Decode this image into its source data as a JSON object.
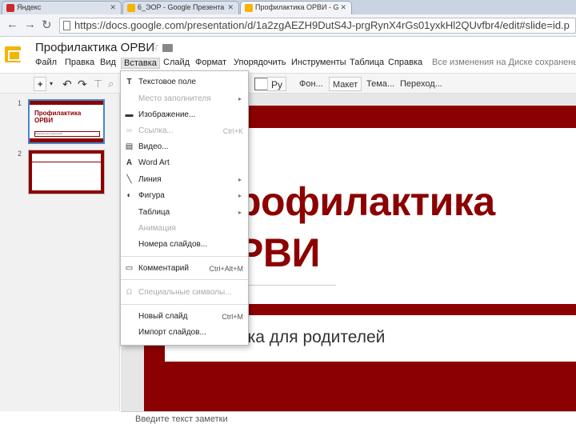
{
  "browser": {
    "tabs": [
      {
        "title": "Яндекс",
        "favicon_color": "#cc2a2a"
      },
      {
        "title": "6_ЭОР - Google Презента",
        "favicon_color": "#f4b400"
      },
      {
        "title": "Профилактика ОРВИ - G",
        "favicon_color": "#f4b400"
      }
    ],
    "address": "https://docs.google.com/presentation/d/1a2zgAEZH9DutS4J-prgRynX4rGs01yxkHl2QUvfbr4/edit#slide=id.p"
  },
  "doc": {
    "title": "Профилактика ОРВИ",
    "save_status": "Все изменения на Диске сохранены"
  },
  "menubar": {
    "items": [
      "Файл",
      "Правка",
      "Вид",
      "Вставка",
      "Слайд",
      "Формат",
      "Упорядочить",
      "Инструменты",
      "Таблица",
      "Справка"
    ],
    "open_item": "Вставка"
  },
  "toolbar": {
    "plus": "+",
    "undo": "↶",
    "redo": "↷",
    "lang": "Ру",
    "background": "Фон...",
    "layout": "Макет",
    "theme": "Тема...",
    "transition": "Переход..."
  },
  "insert_menu": {
    "items": [
      {
        "label": "Текстовое поле",
        "icon": "text-box-icon",
        "glyph": "T",
        "disabled": false
      },
      {
        "label": "Место заполнителя",
        "icon": "",
        "glyph": "",
        "disabled": true,
        "submenu": true
      },
      {
        "label": "Изображение...",
        "icon": "image-icon",
        "glyph": "▬",
        "disabled": false
      },
      {
        "label": "Ссылка...",
        "icon": "link-icon",
        "glyph": "∞",
        "disabled": true,
        "shortcut": "Ctrl+K"
      },
      {
        "label": "Видео...",
        "icon": "video-icon",
        "glyph": "▤",
        "disabled": false
      },
      {
        "label": "Word Art",
        "icon": "word-art-icon",
        "glyph": "A",
        "disabled": false
      },
      {
        "label": "Линия",
        "icon": "line-icon",
        "glyph": "╲",
        "disabled": false,
        "submenu": true
      },
      {
        "label": "Фигура",
        "icon": "shape-icon",
        "glyph": "◐",
        "disabled": false,
        "submenu": true
      },
      {
        "label": "Таблица",
        "icon": "",
        "glyph": "",
        "disabled": false,
        "submenu": true
      },
      {
        "label": "Анимация",
        "icon": "",
        "glyph": "",
        "disabled": true
      },
      {
        "label": "Номера слайдов...",
        "icon": "",
        "glyph": "",
        "disabled": false
      },
      {
        "label": "Комментарий",
        "icon": "comment-icon",
        "glyph": "▭",
        "disabled": false,
        "shortcut": "Ctrl+Alt+M"
      },
      {
        "label": "Специальные символы...",
        "icon": "omega-icon",
        "glyph": "Ω",
        "disabled": true
      },
      {
        "label": "Новый слайд",
        "icon": "",
        "glyph": "",
        "disabled": false,
        "shortcut": "Ctrl+M"
      },
      {
        "label": "Импорт слайдов...",
        "icon": "",
        "glyph": "",
        "disabled": false
      }
    ]
  },
  "filmstrip": {
    "slides": [
      {
        "number": "1",
        "title": "Профилактика ОРВИ",
        "subtitle": "Памятка для родителей"
      },
      {
        "number": "2"
      }
    ]
  },
  "slide": {
    "title_visible": "рофилактика\nРВИ",
    "subtitle_visible": "тка для родителей"
  },
  "notes": {
    "placeholder": "Введите текст заметки"
  }
}
